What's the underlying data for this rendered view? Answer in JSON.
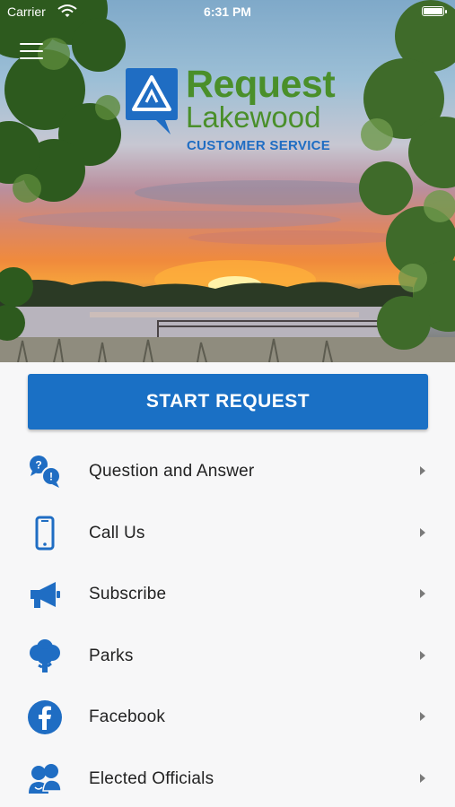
{
  "status_bar": {
    "carrier": "Carrier",
    "time": "6:31 PM"
  },
  "logo": {
    "line1": "Request",
    "line2": "Lakewood",
    "line3": "CUSTOMER SERVICE",
    "colors": {
      "green": "#4a8f2a",
      "blue": "#1f6dc3"
    }
  },
  "start_button": {
    "label": "START REQUEST",
    "color": "#1a70c5"
  },
  "menu_items": [
    {
      "label": "Question and Answer",
      "icon": "question-bubbles-icon"
    },
    {
      "label": "Call Us",
      "icon": "phone-icon"
    },
    {
      "label": "Subscribe",
      "icon": "megaphone-icon"
    },
    {
      "label": "Parks",
      "icon": "tree-icon"
    },
    {
      "label": "Facebook",
      "icon": "facebook-icon"
    },
    {
      "label": "Elected Officials",
      "icon": "people-icon"
    }
  ],
  "accent_color": "#1a70c5"
}
